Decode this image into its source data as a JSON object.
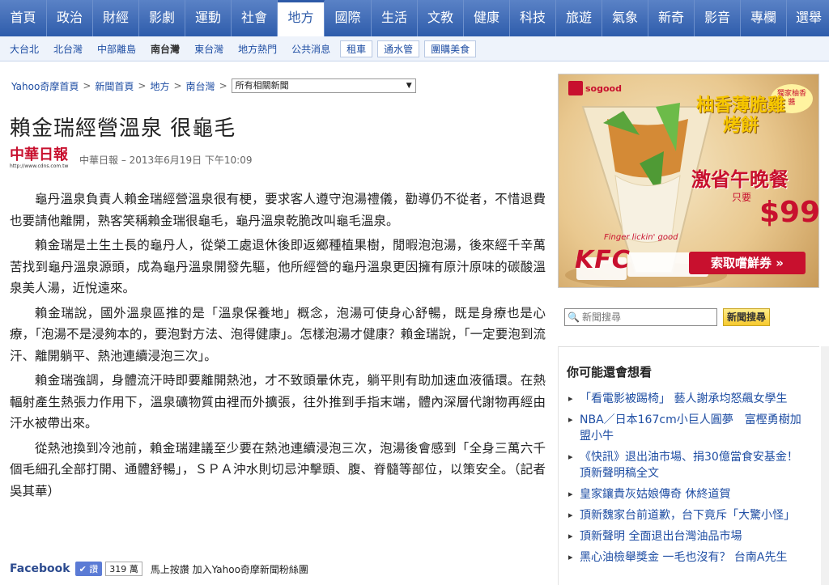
{
  "topnav": [
    "首頁",
    "政治",
    "財經",
    "影劇",
    "運動",
    "社會",
    "地方",
    "國際",
    "生活",
    "文教",
    "健康",
    "科技",
    "旅遊",
    "氣象",
    "新奇",
    "影音",
    "專欄",
    "選舉"
  ],
  "topnav_active": "地方",
  "subnav": {
    "items": [
      "大台北",
      "北台灣",
      "中部離島",
      "南台灣",
      "東台灣",
      "地方熱門",
      "公共消息"
    ],
    "active": "南台灣",
    "boxed": [
      "租車",
      "通水管",
      "團購美食"
    ]
  },
  "breadcrumb": {
    "items": [
      "Yahoo奇摩首頁",
      "新聞首頁",
      "地方",
      "南台灣"
    ],
    "select_value": "所有相關新聞"
  },
  "article": {
    "title": "賴金瑞經營溫泉 很龜毛",
    "source_logo": "中華日報",
    "source_url": "http://www.cdns.com.tw",
    "byline": "中華日報 – 2013年6月19日 下午10:09",
    "paragraphs": [
      "龜丹溫泉負責人賴金瑞經營溫泉很有梗，要求客人遵守泡湯禮儀，勸導仍不從者，不惜退費也要請他離開，熟客笑稱賴金瑞很龜毛，龜丹溫泉乾脆改叫龜毛溫泉。",
      "賴金瑞是土生土長的龜丹人，從榮工處退休後即返鄉種植果樹，閒暇泡泡湯，後來經千辛萬苦找到龜丹溫泉源頭，成為龜丹溫泉開發先驅，他所經營的龜丹溫泉更因擁有原汁原味的碳酸溫泉美人湯，近悅遠來。",
      "賴金瑞說，國外溫泉區推的是「溫泉保養地」概念，泡湯可使身心舒暢，既是身療也是心療，「泡湯不是浸夠本的，要泡對方法、泡得健康」。怎樣泡湯才健康？賴金瑞說，「一定要泡到流汗、離開躺平、熱池連續浸泡三次」。",
      "賴金瑞強調，身體流汗時即要離開熱池，才不致頭暈休克，躺平則有助加速血液循環。在熱輻射產生熱張力作用下，溫泉礦物質由裡而外擴張，往外推到手指末端，體內深層代謝物再經由汗水被帶出來。",
      "從熱池換到冷池前，賴金瑞建議至少要在熱池連續浸泡三次，泡湯後會感到「全身三萬六千個毛細孔全部打開、通體舒暢」，ＳＰＡ沖水則切忌沖擊頭、腹、脊髓等部位，以策安全。（記者吳其華）"
    ]
  },
  "facebook": {
    "label": "Facebook",
    "like": "讚",
    "count": "319 萬",
    "text": "馬上按讚 加入Yahoo奇摩新聞粉絲團"
  },
  "ad": {
    "brand": "KFC",
    "partner": "sogood",
    "product": "柚香薄脆雞烤餅",
    "badge": "獨家柚香醬",
    "promo": "激省午晚餐",
    "price_prefix": "只要",
    "price": "$99",
    "cta": "索取嚐鮮券",
    "slogan": "Finger lickin' good"
  },
  "search": {
    "placeholder": "新聞搜尋",
    "button": "新聞搜尋"
  },
  "related": {
    "title": "你可能還會想看",
    "items": [
      "「看電影被踢椅」 藝人謝承均怒飆女學生",
      "NBA／日本167cm小巨人圓夢　富樫勇樹加盟小牛",
      "《快訊》退出油市場、捐30億當食安基金！　頂新聲明稿全文",
      "皇家鑲貴灰姑娘傳奇 休終道賀",
      "頂新魏家台前道歉，台下竟斥「大驚小怪」",
      "頂新聲明 全面退出台灣油品市場",
      "黑心油檢舉獎金 一毛也沒有？ 台南A先生"
    ]
  }
}
